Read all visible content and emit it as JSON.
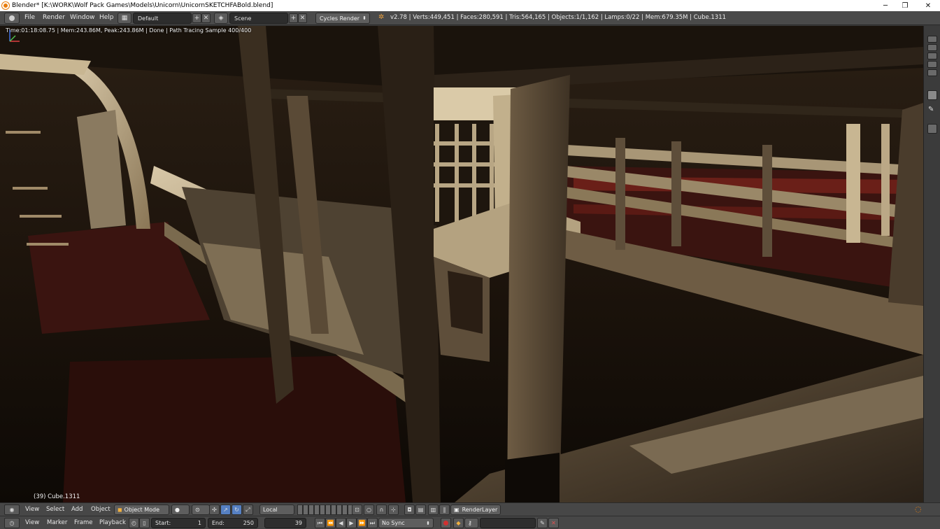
{
  "window": {
    "title": "Blender* [K:\\WORK\\Wolf Pack Games\\Models\\Unicorn\\UnicornSKETCHFABold.blend]",
    "controls": {
      "minimize": "─",
      "restore": "❐",
      "close": "✕"
    }
  },
  "topbar": {
    "menu": [
      "File",
      "Render",
      "Window",
      "Help"
    ],
    "layout_value": "Default",
    "scene_value": "Scene",
    "render_engine": "Cycles Render",
    "stats": "v2.78 | Verts:449,451 | Faces:280,591 | Tris:564,165 | Objects:1/1,162 | Lamps:0/22 | Mem:679.35M | Cube.1311"
  },
  "viewport": {
    "render_status": "Time:01:18:08.75 | Mem:243.86M, Peak:243.86M | Done | Path Tracing Sample 400/400",
    "object_label": "(39) Cube.1311"
  },
  "viewport_header": {
    "menu": [
      "View",
      "Select",
      "Add",
      "Object"
    ],
    "mode": "Object Mode",
    "orientation": "Local",
    "render_layer": "RenderLayer"
  },
  "timeline": {
    "menu": [
      "View",
      "Marker",
      "Frame",
      "Playback"
    ],
    "start_label": "Start:",
    "start_value": "1",
    "end_label": "End:",
    "end_value": "250",
    "current_frame": "39",
    "sync": "No Sync"
  },
  "colors": {
    "accent": "#e87d0d",
    "header_bg": "#4a4a4a",
    "active_button": "#5680c2",
    "record_button": "#d03030"
  }
}
